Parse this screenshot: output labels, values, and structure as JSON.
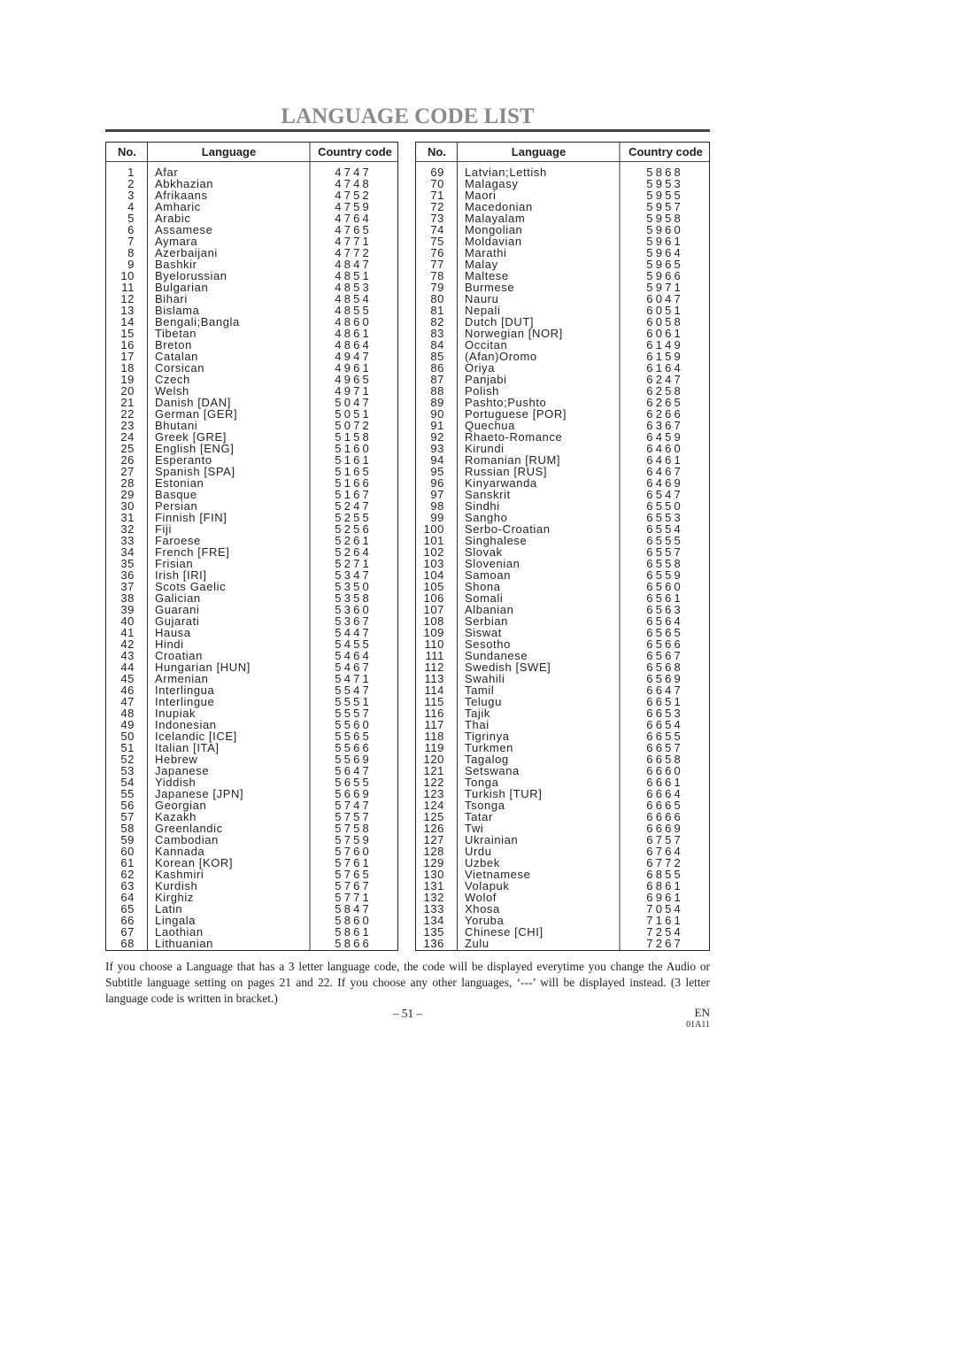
{
  "page": {
    "title": "LANGUAGE CODE LIST",
    "headers": {
      "no": "No.",
      "language": "Language",
      "code": "Country code"
    },
    "note": "If you choose a Language that has a 3 letter language code, the code will be displayed everytime you change the Audio or Subtitle language setting on pages 21 and 22. If you choose any other languages, ‘---’ will be displayed instead. (3 letter language code is written in bracket.)",
    "page_number": "– 51 –",
    "language_tag": "EN",
    "doc_code": "01A11"
  },
  "left_table": [
    [
      "1",
      "Afar",
      "4747"
    ],
    [
      "2",
      "Abkhazian",
      "4748"
    ],
    [
      "3",
      "Afrikaans",
      "4752"
    ],
    [
      "4",
      "Amharic",
      "4759"
    ],
    [
      "5",
      "Arabic",
      "4764"
    ],
    [
      "6",
      "Assamese",
      "4765"
    ],
    [
      "7",
      "Aymara",
      "4771"
    ],
    [
      "8",
      "Azerbaijani",
      "4772"
    ],
    [
      "9",
      "Bashkir",
      "4847"
    ],
    [
      "10",
      "Byelorussian",
      "4851"
    ],
    [
      "11",
      "Bulgarian",
      "4853"
    ],
    [
      "12",
      "Bihari",
      "4854"
    ],
    [
      "13",
      "Bislama",
      "4855"
    ],
    [
      "14",
      "Bengali;Bangla",
      "4860"
    ],
    [
      "15",
      "Tibetan",
      "4861"
    ],
    [
      "16",
      "Breton",
      "4864"
    ],
    [
      "17",
      "Catalan",
      "4947"
    ],
    [
      "18",
      "Corsican",
      "4961"
    ],
    [
      "19",
      "Czech",
      "4965"
    ],
    [
      "20",
      "Welsh",
      "4971"
    ],
    [
      "21",
      "Danish [DAN]",
      "5047"
    ],
    [
      "22",
      "German [GER]",
      "5051"
    ],
    [
      "23",
      "Bhutani",
      "5072"
    ],
    [
      "24",
      "Greek [GRE]",
      "5158"
    ],
    [
      "25",
      "English [ENG]",
      "5160"
    ],
    [
      "26",
      "Esperanto",
      "5161"
    ],
    [
      "27",
      "Spanish [SPA]",
      "5165"
    ],
    [
      "28",
      "Estonian",
      "5166"
    ],
    [
      "29",
      "Basque",
      "5167"
    ],
    [
      "30",
      "Persian",
      "5247"
    ],
    [
      "31",
      "Finnish [FIN]",
      "5255"
    ],
    [
      "32",
      "Fiji",
      "5256"
    ],
    [
      "33",
      "Faroese",
      "5261"
    ],
    [
      "34",
      "French [FRE]",
      "5264"
    ],
    [
      "35",
      "Frisian",
      "5271"
    ],
    [
      "36",
      "Irish [IRI]",
      "5347"
    ],
    [
      "37",
      "Scots Gaelic",
      "5350"
    ],
    [
      "38",
      "Galician",
      "5358"
    ],
    [
      "39",
      "Guarani",
      "5360"
    ],
    [
      "40",
      "Gujarati",
      "5367"
    ],
    [
      "41",
      "Hausa",
      "5447"
    ],
    [
      "42",
      "Hindi",
      "5455"
    ],
    [
      "43",
      "Croatian",
      "5464"
    ],
    [
      "44",
      "Hungarian [HUN]",
      "5467"
    ],
    [
      "45",
      "Armenian",
      "5471"
    ],
    [
      "46",
      "Interlingua",
      "5547"
    ],
    [
      "47",
      "Interlingue",
      "5551"
    ],
    [
      "48",
      "Inupiak",
      "5557"
    ],
    [
      "49",
      "Indonesian",
      "5560"
    ],
    [
      "50",
      "Icelandic [ICE]",
      "5565"
    ],
    [
      "51",
      "Italian [ITA]",
      "5566"
    ],
    [
      "52",
      "Hebrew",
      "5569"
    ],
    [
      "53",
      "Japanese",
      "5647"
    ],
    [
      "54",
      "Yiddish",
      "5655"
    ],
    [
      "55",
      "Japanese [JPN]",
      "5669"
    ],
    [
      "56",
      "Georgian",
      "5747"
    ],
    [
      "57",
      "Kazakh",
      "5757"
    ],
    [
      "58",
      "Greenlandic",
      "5758"
    ],
    [
      "59",
      "Cambodian",
      "5759"
    ],
    [
      "60",
      "Kannada",
      "5760"
    ],
    [
      "61",
      "Korean [KOR]",
      "5761"
    ],
    [
      "62",
      "Kashmiri",
      "5765"
    ],
    [
      "63",
      "Kurdish",
      "5767"
    ],
    [
      "64",
      "Kirghiz",
      "5771"
    ],
    [
      "65",
      "Latin",
      "5847"
    ],
    [
      "66",
      "Lingala",
      "5860"
    ],
    [
      "67",
      "Laothian",
      "5861"
    ],
    [
      "68",
      "Lithuanian",
      "5866"
    ]
  ],
  "right_table": [
    [
      "69",
      "Latvian;Lettish",
      "5868"
    ],
    [
      "70",
      "Malagasy",
      "5953"
    ],
    [
      "71",
      "Maori",
      "5955"
    ],
    [
      "72",
      "Macedonian",
      "5957"
    ],
    [
      "73",
      "Malayalam",
      "5958"
    ],
    [
      "74",
      "Mongolian",
      "5960"
    ],
    [
      "75",
      "Moldavian",
      "5961"
    ],
    [
      "76",
      "Marathi",
      "5964"
    ],
    [
      "77",
      "Malay",
      "5965"
    ],
    [
      "78",
      "Maltese",
      "5966"
    ],
    [
      "79",
      "Burmese",
      "5971"
    ],
    [
      "80",
      "Nauru",
      "6047"
    ],
    [
      "81",
      "Nepali",
      "6051"
    ],
    [
      "82",
      "Dutch [DUT]",
      "6058"
    ],
    [
      "83",
      "Norwegian [NOR]",
      "6061"
    ],
    [
      "84",
      "Occitan",
      "6149"
    ],
    [
      "85",
      "(Afan)Oromo",
      "6159"
    ],
    [
      "86",
      "Oriya",
      "6164"
    ],
    [
      "87",
      "Panjabi",
      "6247"
    ],
    [
      "88",
      "Polish",
      "6258"
    ],
    [
      "89",
      "Pashto;Pushto",
      "6265"
    ],
    [
      "90",
      "Portuguese [POR]",
      "6266"
    ],
    [
      "91",
      "Quechua",
      "6367"
    ],
    [
      "92",
      "Rhaeto-Romance",
      "6459"
    ],
    [
      "93",
      "Kirundi",
      "6460"
    ],
    [
      "94",
      "Romanian [RUM]",
      "6461"
    ],
    [
      "95",
      "Russian [RUS]",
      "6467"
    ],
    [
      "96",
      "Kinyarwanda",
      "6469"
    ],
    [
      "97",
      "Sanskrit",
      "6547"
    ],
    [
      "98",
      "Sindhi",
      "6550"
    ],
    [
      "99",
      "Sangho",
      "6553"
    ],
    [
      "100",
      "Serbo-Croatian",
      "6554"
    ],
    [
      "101",
      "Singhalese",
      "6555"
    ],
    [
      "102",
      "Slovak",
      "6557"
    ],
    [
      "103",
      "Slovenian",
      "6558"
    ],
    [
      "104",
      "Samoan",
      "6559"
    ],
    [
      "105",
      "Shona",
      "6560"
    ],
    [
      "106",
      "Somali",
      "6561"
    ],
    [
      "107",
      "Albanian",
      "6563"
    ],
    [
      "108",
      "Serbian",
      "6564"
    ],
    [
      "109",
      "Siswat",
      "6565"
    ],
    [
      "110",
      "Sesotho",
      "6566"
    ],
    [
      "111",
      "Sundanese",
      "6567"
    ],
    [
      "112",
      "Swedish [SWE]",
      "6568"
    ],
    [
      "113",
      "Swahili",
      "6569"
    ],
    [
      "114",
      "Tamil",
      "6647"
    ],
    [
      "115",
      "Telugu",
      "6651"
    ],
    [
      "116",
      "Tajik",
      "6653"
    ],
    [
      "117",
      "Thai",
      "6654"
    ],
    [
      "118",
      "Tigrinya",
      "6655"
    ],
    [
      "119",
      "Turkmen",
      "6657"
    ],
    [
      "120",
      "Tagalog",
      "6658"
    ],
    [
      "121",
      "Setswana",
      "6660"
    ],
    [
      "122",
      "Tonga",
      "6661"
    ],
    [
      "123",
      "Turkish [TUR]",
      "6664"
    ],
    [
      "124",
      "Tsonga",
      "6665"
    ],
    [
      "125",
      "Tatar",
      "6666"
    ],
    [
      "126",
      "Twi",
      "6669"
    ],
    [
      "127",
      "Ukrainian",
      "6757"
    ],
    [
      "128",
      "Urdu",
      "6764"
    ],
    [
      "129",
      "Uzbek",
      "6772"
    ],
    [
      "130",
      "Vietnamese",
      "6855"
    ],
    [
      "131",
      "Volapuk",
      "6861"
    ],
    [
      "132",
      "Wolof",
      "6961"
    ],
    [
      "133",
      "Xhosa",
      "7054"
    ],
    [
      "134",
      "Yoruba",
      "7161"
    ],
    [
      "135",
      "Chinese [CHI]",
      "7254"
    ],
    [
      "136",
      "Zulu",
      "7267"
    ]
  ]
}
